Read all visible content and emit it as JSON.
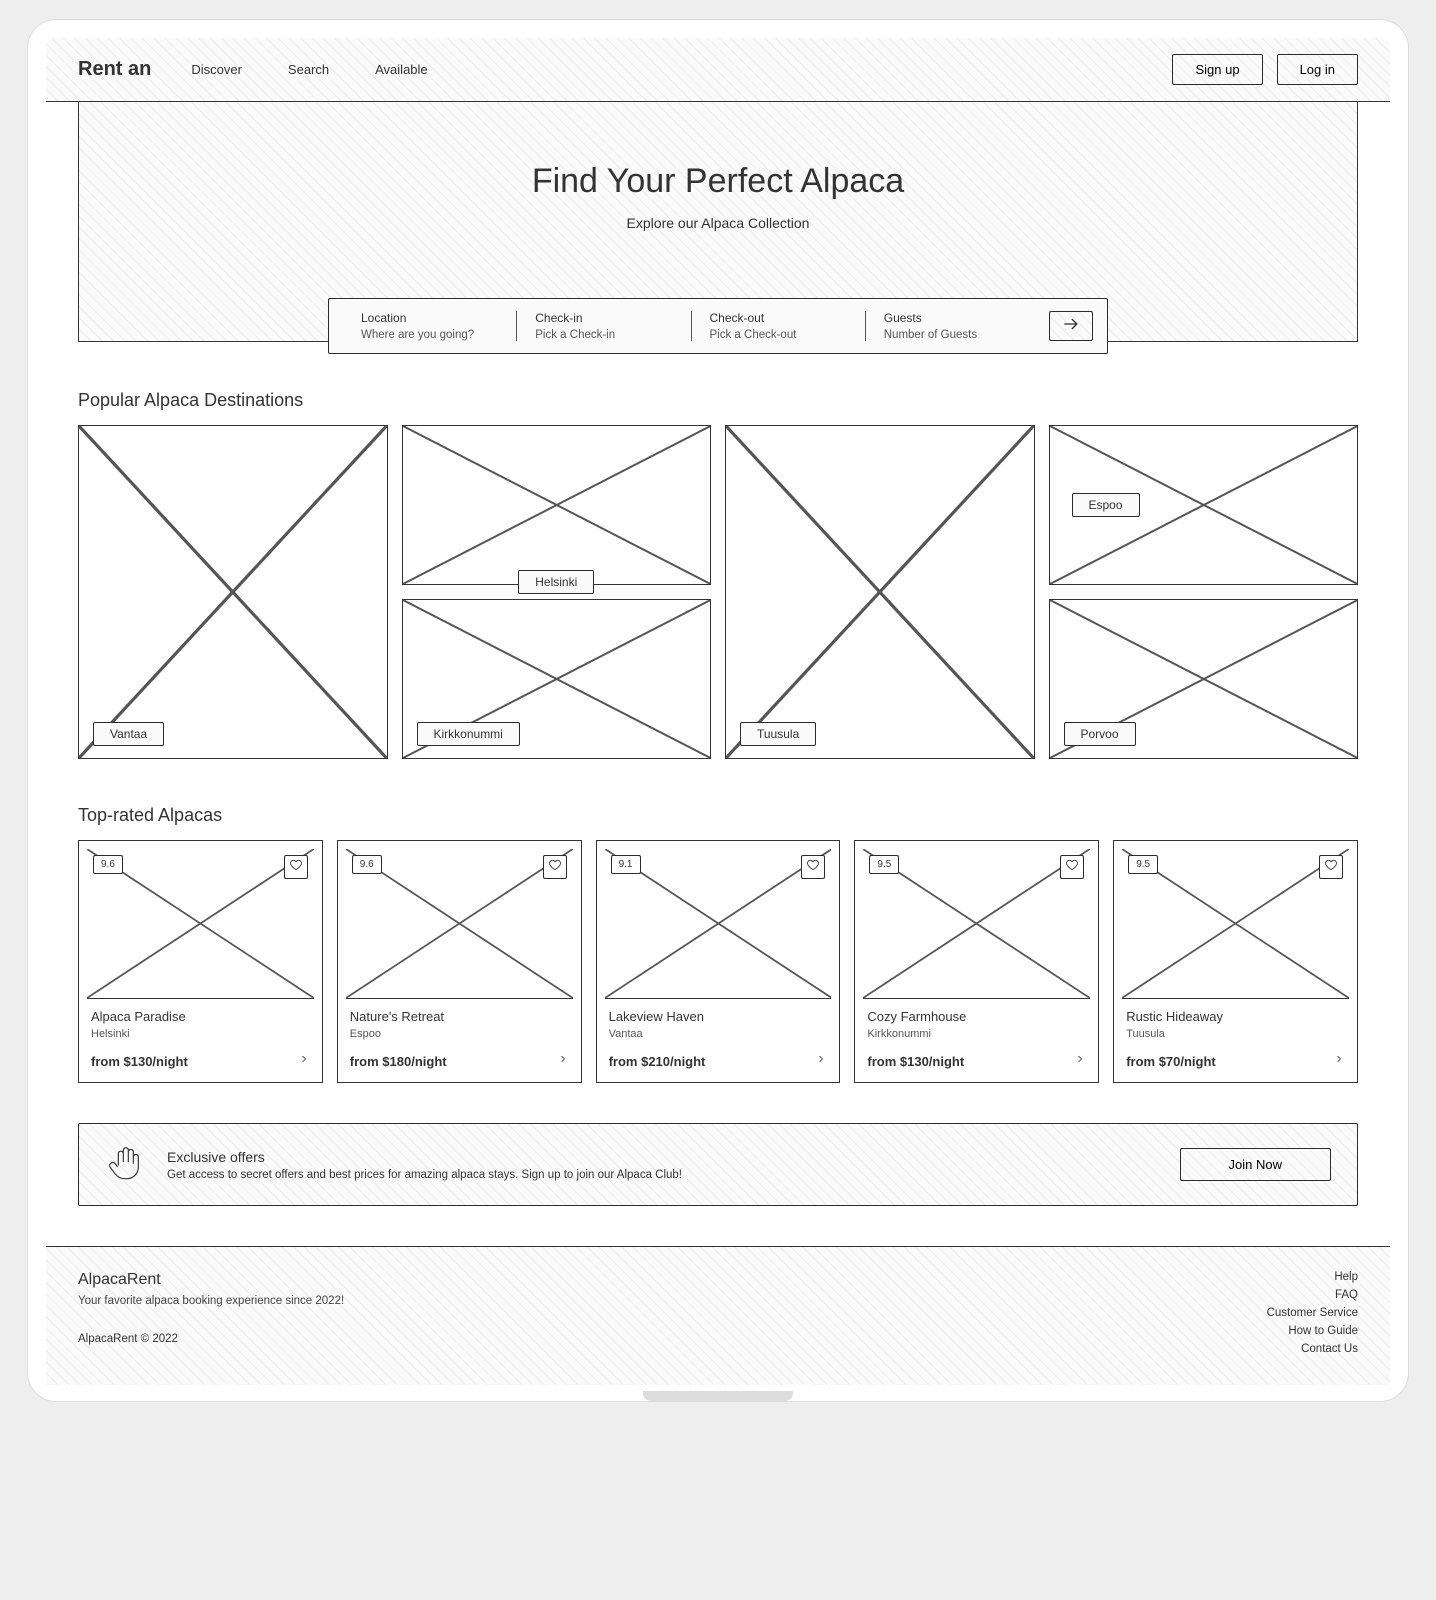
{
  "header": {
    "brand": "Rent an",
    "nav": [
      "Discover",
      "Search",
      "Available"
    ],
    "signup": "Sign up",
    "login": "Log in"
  },
  "hero": {
    "title": "Find Your Perfect Alpaca",
    "subtitle": "Explore our Alpaca Collection"
  },
  "search": {
    "location": {
      "label": "Location",
      "placeholder": "Where are you going?"
    },
    "checkin": {
      "label": "Check-in",
      "placeholder": "Pick a Check-in"
    },
    "checkout": {
      "label": "Check-out",
      "placeholder": "Pick a Check-out"
    },
    "guests": {
      "label": "Guests",
      "placeholder": "Number of Guests"
    }
  },
  "destinations": {
    "heading": "Popular Alpaca Destinations",
    "items": [
      "Vantaa",
      "Helsinki",
      "Kirkkonummi",
      "Tuusula",
      "Espoo",
      "Porvoo"
    ]
  },
  "toprated": {
    "heading": "Top-rated Alpacas",
    "items": [
      {
        "rating": "9.6",
        "title": "Alpaca Paradise",
        "location": "Helsinki",
        "price": "from $130/night"
      },
      {
        "rating": "9.6",
        "title": "Nature's Retreat",
        "location": "Espoo",
        "price": "from $180/night"
      },
      {
        "rating": "9.1",
        "title": "Lakeview Haven",
        "location": "Vantaa",
        "price": "from $210/night"
      },
      {
        "rating": "9.5",
        "title": "Cozy Farmhouse",
        "location": "Kirkkonummi",
        "price": "from $130/night"
      },
      {
        "rating": "9.5",
        "title": "Rustic Hideaway",
        "location": "Tuusula",
        "price": "from $70/night"
      }
    ]
  },
  "promo": {
    "title": "Exclusive offers",
    "desc": "Get access to secret offers and best prices for amazing alpaca stays. Sign up to join our Alpaca Club!",
    "cta": "Join Now"
  },
  "footer": {
    "brand": "AlpacaRent",
    "tagline": "Your favorite alpaca booking experience since 2022!",
    "copyright": "AlpacaRent © 2022",
    "links": [
      "Help",
      "FAQ",
      "Customer Service",
      "How to Guide",
      "Contact Us"
    ]
  }
}
